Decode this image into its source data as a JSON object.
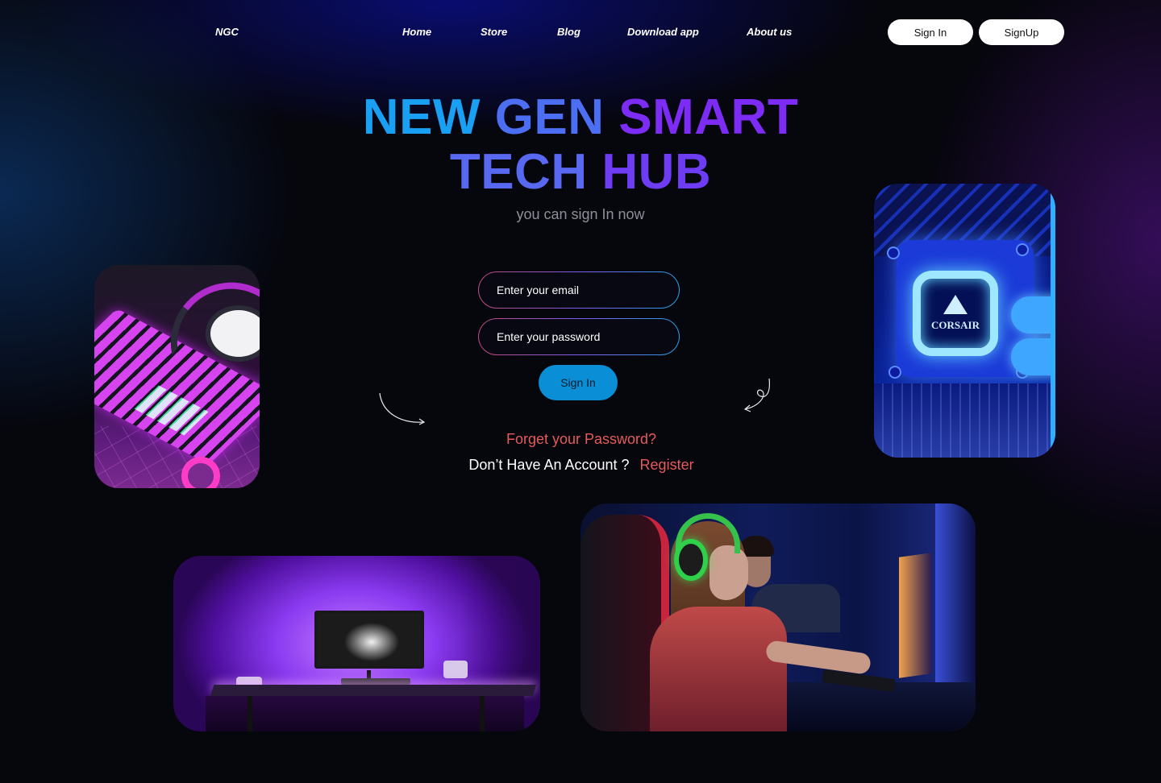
{
  "header": {
    "logo": "NGC",
    "nav": [
      {
        "label": "Home"
      },
      {
        "label": "Store"
      },
      {
        "label": "Blog"
      },
      {
        "label": "Download app"
      },
      {
        "label": "About us"
      }
    ],
    "signin_label": "Sign In",
    "signup_label": "SignUp"
  },
  "hero": {
    "title_words": [
      "NEW",
      "GEN",
      "SMART",
      "TECH",
      "HUB"
    ],
    "subtitle": "you can sign In now"
  },
  "form": {
    "email_placeholder": "Enter your email",
    "password_placeholder": "Enter your password",
    "submit_label": "Sign In",
    "forgot_label": "Forget your Password?",
    "no_account_label": "Don’t Have An Account ?",
    "register_label": "Register"
  },
  "images": {
    "cooler_brand": "CORSAIR",
    "keyboard": "keyboard-headset-photo",
    "cooler": "cpu-cooler-photo",
    "desk": "desk-setup-photo",
    "gamers": "gamers-photo"
  },
  "colors": {
    "background": "#06060d",
    "accent_blue": "#0a8fd6",
    "title_cyan": "#1aa0f2",
    "title_purple": "#7d2cf6",
    "link_red": "#e65a5a"
  }
}
